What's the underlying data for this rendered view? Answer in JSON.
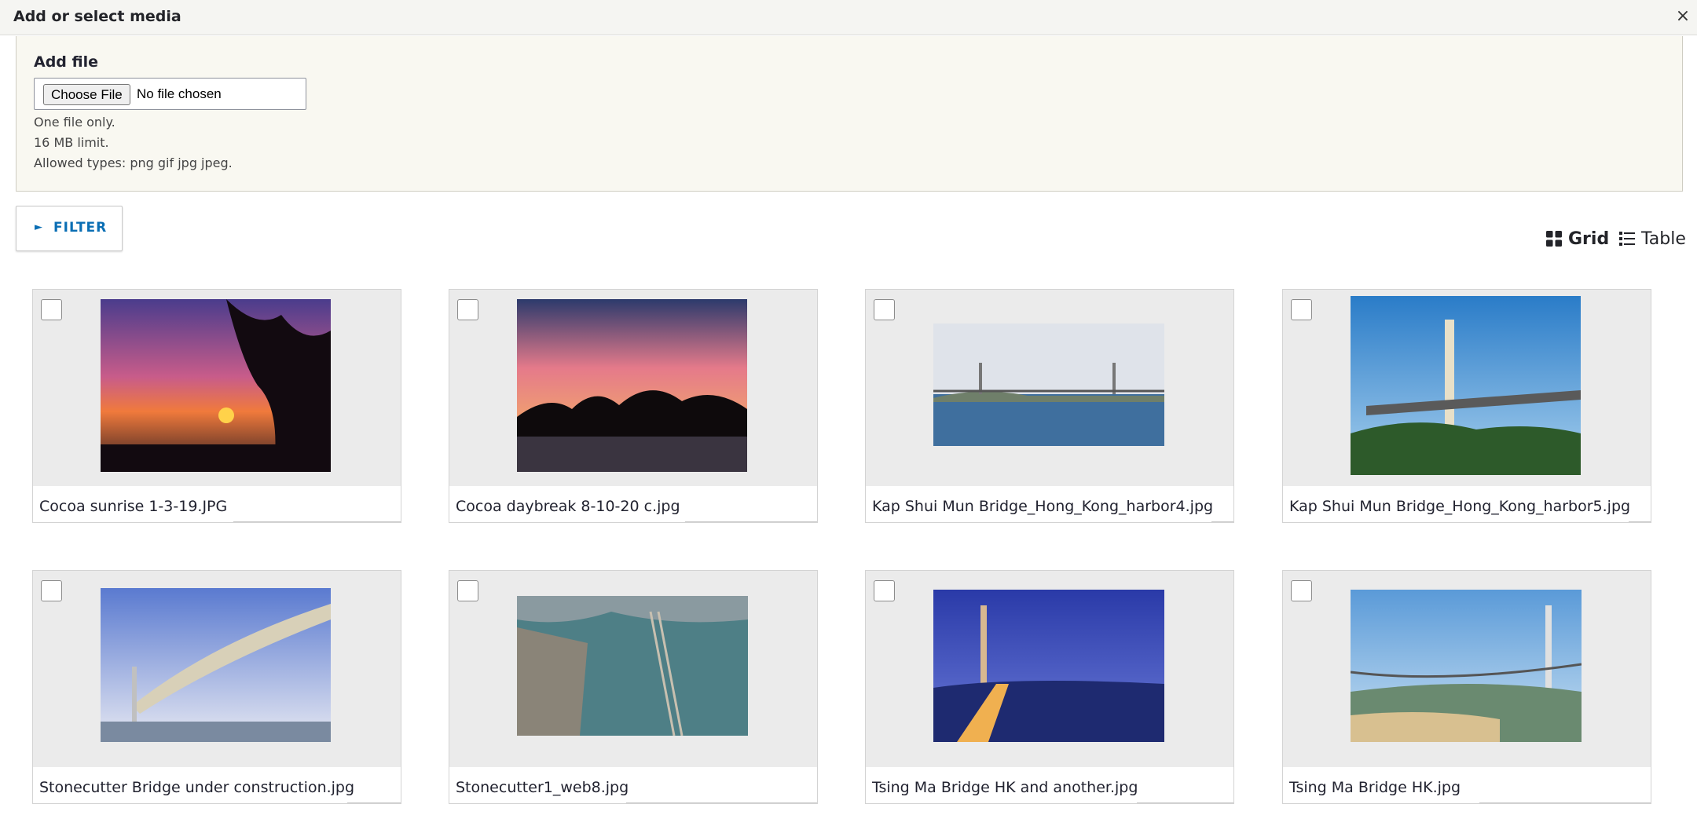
{
  "dialog": {
    "title": "Add or select media",
    "close_glyph": "×"
  },
  "add_file": {
    "label": "Add file",
    "choose_label": "Choose File",
    "status": "No file chosen",
    "help": [
      "One file only.",
      "16 MB limit.",
      "Allowed types: png gif jpg jpeg."
    ]
  },
  "filter": {
    "label": "FILTER",
    "toggle_glyph": "►"
  },
  "views": {
    "grid_label": "Grid",
    "table_label": "Table",
    "active": "grid"
  },
  "colors": {
    "accent_link": "#0a6eb4",
    "card_bg": "#ebebeb"
  },
  "media": [
    {
      "filename": "Cocoa sunrise 1-3-19.JPG",
      "icon": "sunset-photo-thumbnail"
    },
    {
      "filename": "Cocoa daybreak 8-10-20 c.jpg",
      "icon": "sunset-palms-photo-thumbnail"
    },
    {
      "filename": "Kap Shui Mun Bridge_Hong_Kong_harbor4.jpg",
      "icon": "bridge-photo-thumbnail"
    },
    {
      "filename": "Kap Shui Mun Bridge_Hong_Kong_harbor5.jpg",
      "icon": "bridge-photo-thumbnail"
    },
    {
      "filename": "Stonecutter Bridge under construction.jpg",
      "icon": "bridge-construction-photo-thumbnail"
    },
    {
      "filename": "Stonecutter1_web8.jpg",
      "icon": "harbor-aerial-photo-thumbnail"
    },
    {
      "filename": "Tsing Ma Bridge HK and another.jpg",
      "icon": "night-bridge-photo-thumbnail"
    },
    {
      "filename": "Tsing Ma Bridge HK.jpg",
      "icon": "suspension-bridge-photo-thumbnail"
    }
  ]
}
